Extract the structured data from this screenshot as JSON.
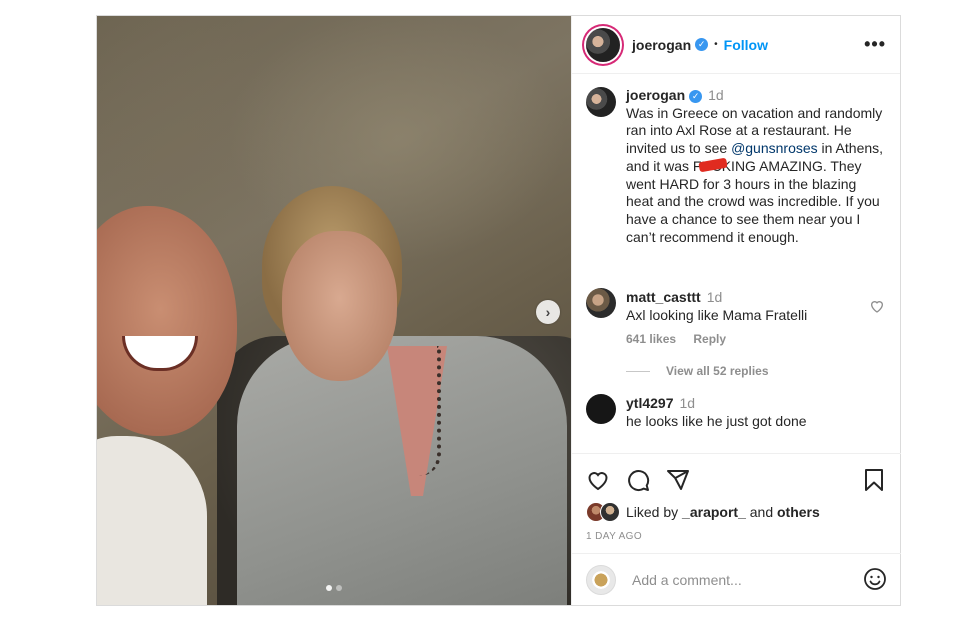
{
  "post": {
    "image_dots": 2,
    "active_dot": 0
  },
  "header": {
    "username": "joerogan",
    "separator": "•",
    "follow_label": "Follow",
    "more_label": "•••"
  },
  "caption": {
    "username": "joerogan",
    "time": "1d",
    "text_1": "Was in Greece on vacation and randomly ran into Axl Rose at a restaurant. He invited us to see ",
    "mention": "@gunsnroses",
    "text_2": " in Athens, and it was F",
    "censored": "UC",
    "text_3": "KING AMAZING. They went HARD for 3 hours in the blazing heat and the crowd was incredible. If you have a chance to see them near you I can’t recommend it enough."
  },
  "comments": [
    {
      "username": "matt_casttt",
      "time": "1d",
      "text": "Axl looking like Mama Fratelli",
      "likes": "641 likes",
      "reply_label": "Reply",
      "view_replies": "View all 52 replies"
    },
    {
      "username": "ytl4297",
      "time": "1d",
      "text": "he looks like he just got done"
    }
  ],
  "likes": {
    "prefix": "Liked by ",
    "user": "_araport_",
    "and": " and ",
    "others": "others"
  },
  "timestamp": "1 DAY AGO",
  "add_comment": {
    "placeholder": "Add a comment..."
  },
  "icons": {
    "like": "heart-icon",
    "comment": "comment-icon",
    "share": "share-icon",
    "save": "bookmark-icon",
    "emoji": "emoji-icon",
    "next": "chevron-right-icon"
  },
  "colors": {
    "link": "#0095f6",
    "verified": "#3897f0",
    "mention": "#00376b",
    "muted": "#8e8e8e"
  }
}
